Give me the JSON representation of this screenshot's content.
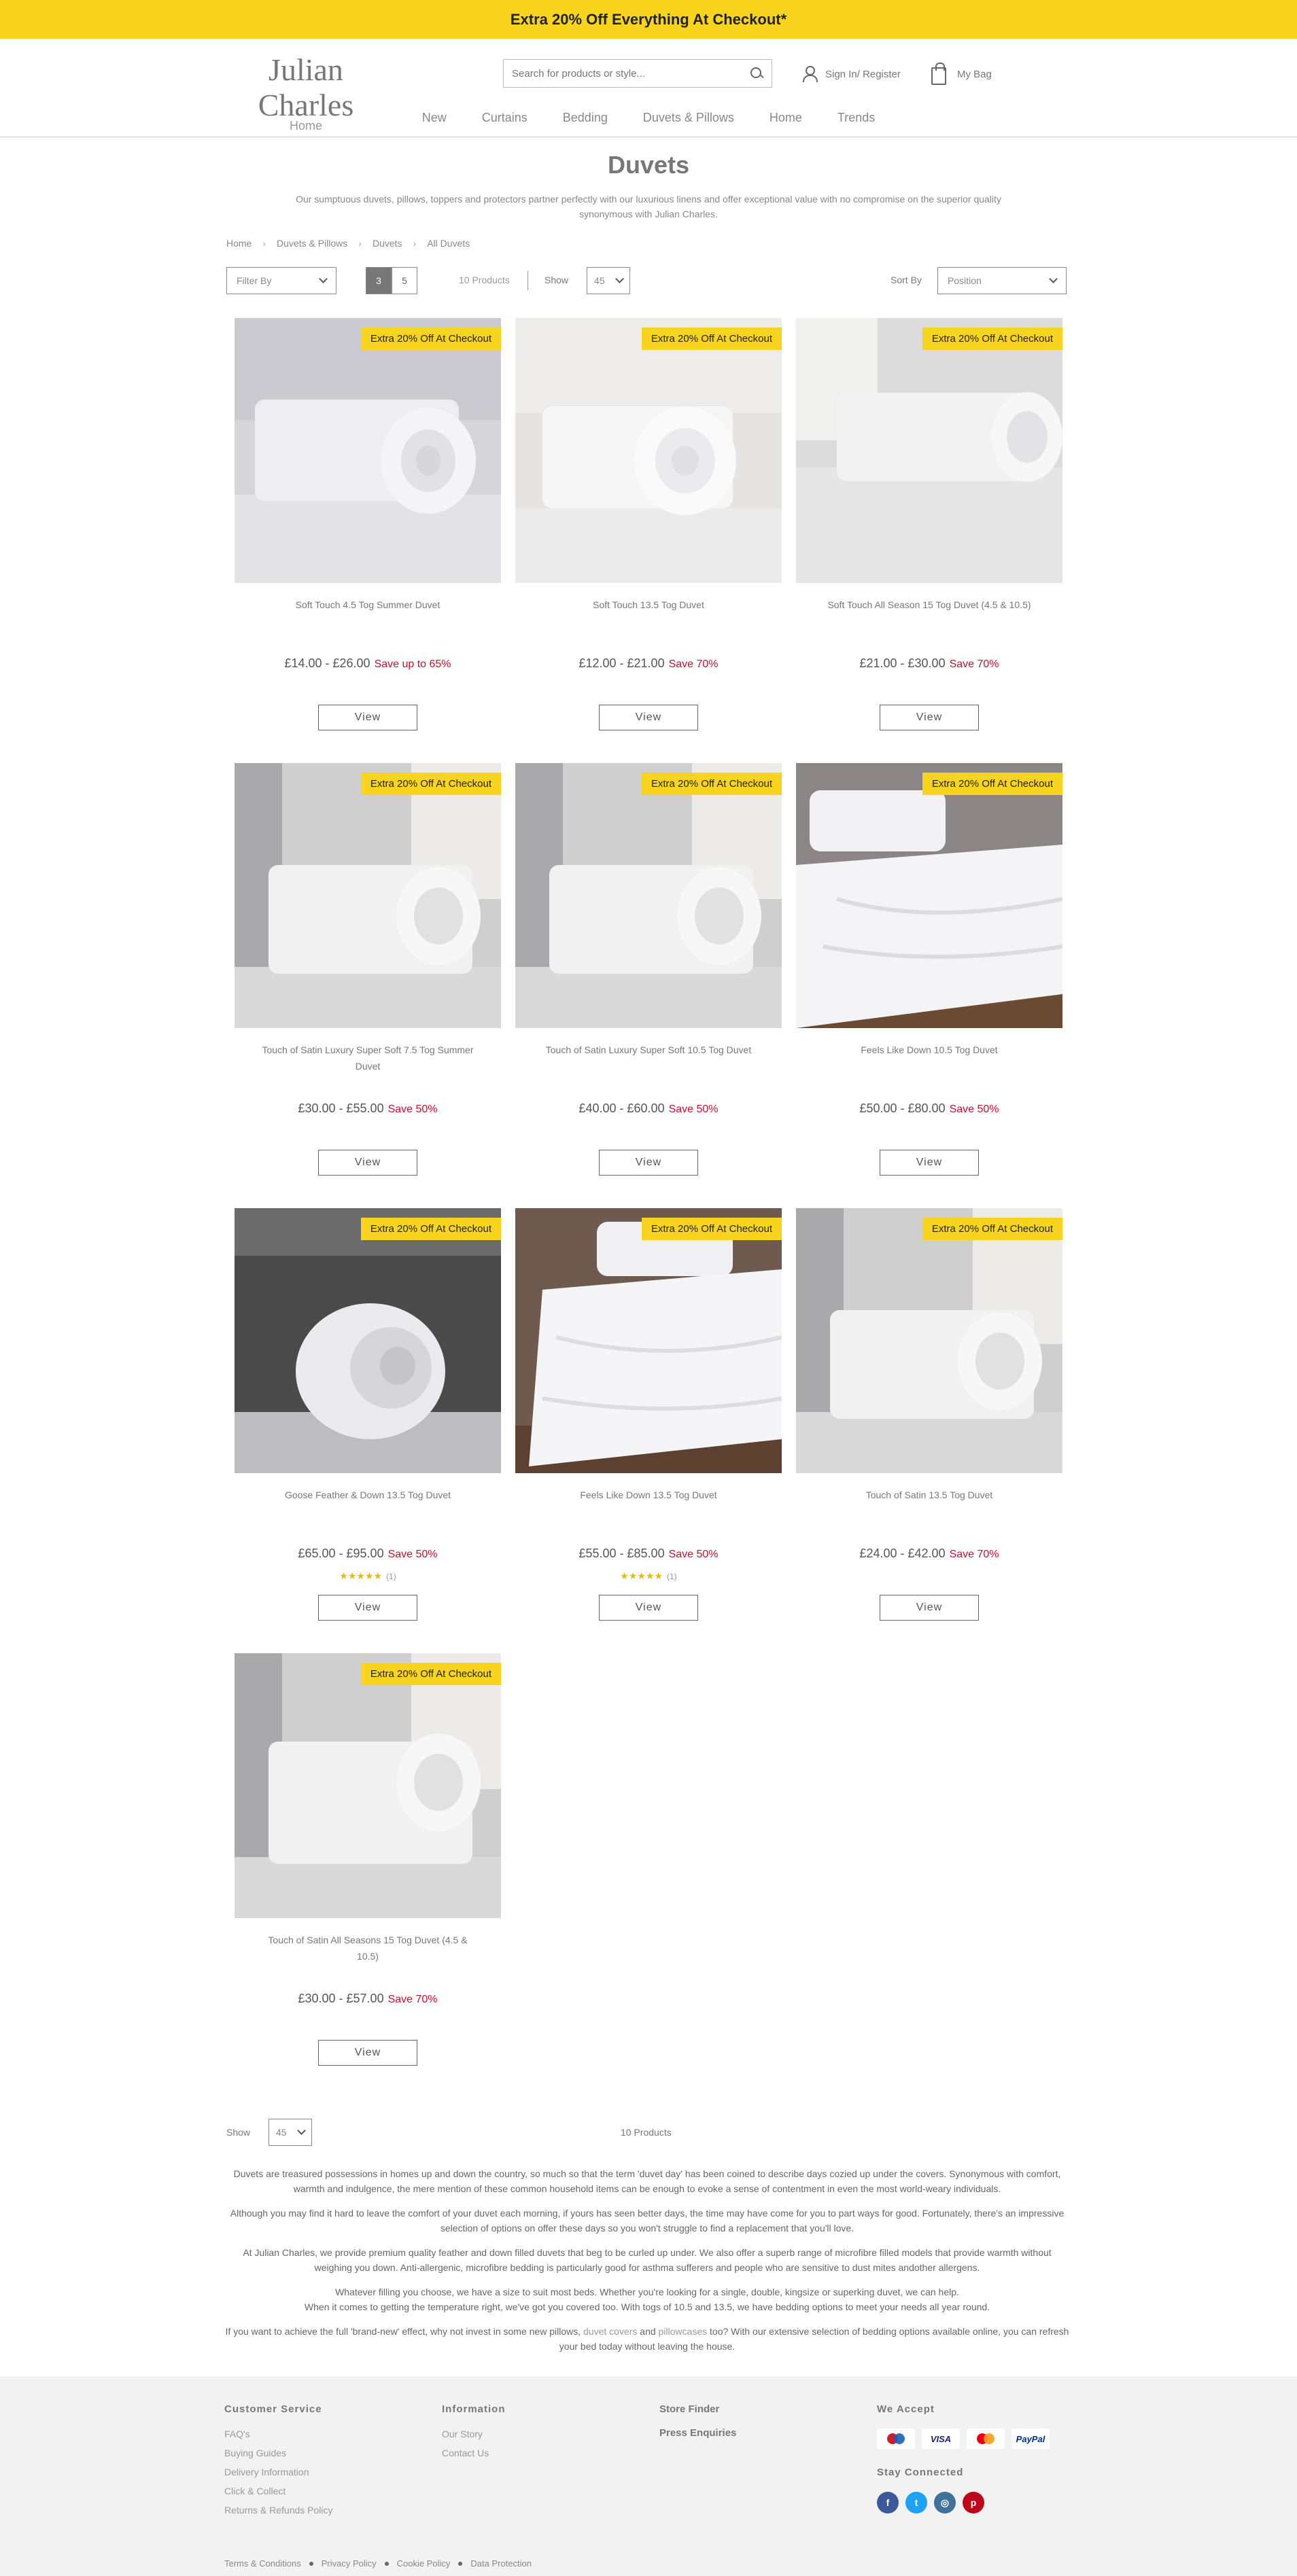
{
  "promo": {
    "text": "Extra 20% Off Everything At Checkout*"
  },
  "header": {
    "brand": "Julian Charles",
    "brand_sub": "Home",
    "search_placeholder": "Search for products or style...",
    "account": "Sign In/ Register",
    "bag": "My Bag"
  },
  "nav": [
    "New",
    "Curtains",
    "Bedding",
    "Duvets & Pillows",
    "Home",
    "Trends"
  ],
  "page": {
    "title": "Duvets",
    "intro": "Our sumptuous duvets, pillows, toppers and protectors partner perfectly with our luxurious linens and offer exceptional value with no compromise on the superior quality synonymous with Julian Charles."
  },
  "breadcrumb": [
    "Home",
    "Duvets & Pillows",
    "Duvets",
    "All Duvets"
  ],
  "toolbar": {
    "filter": "Filter By",
    "view_modes": [
      "3",
      "5"
    ],
    "count": "10 Products",
    "show_label": "Show",
    "show_value": "45",
    "sort_label": "Sort By",
    "sort_value": "Position"
  },
  "badge": "Extra 20% Off At Checkout",
  "view_label": "View",
  "products": [
    {
      "name": "Soft Touch 4.5 Tog Summer Duvet",
      "price": "£14.00 - £26.00",
      "save": "Save up to 65%",
      "rating": ""
    },
    {
      "name": "Soft Touch 13.5 Tog Duvet",
      "price": "£12.00 - £21.00",
      "save": "Save 70%",
      "rating": ""
    },
    {
      "name": "Soft Touch All Season 15 Tog Duvet (4.5 & 10.5)",
      "price": "£21.00 - £30.00",
      "save": "Save 70%",
      "rating": ""
    },
    {
      "name": "Touch of Satin Luxury Super Soft 7.5 Tog Summer Duvet",
      "price": "£30.00 - £55.00",
      "save": "Save 50%",
      "rating": ""
    },
    {
      "name": "Touch of Satin Luxury Super Soft 10.5 Tog Duvet",
      "price": "£40.00 - £60.00",
      "save": "Save 50%",
      "rating": ""
    },
    {
      "name": "Feels Like Down 10.5 Tog Duvet",
      "price": "£50.00 - £80.00",
      "save": "Save 50%",
      "rating": ""
    },
    {
      "name": "Goose Feather & Down 13.5 Tog Duvet",
      "price": "£65.00 - £95.00",
      "save": "Save 50%",
      "rating": "★★★★★",
      "rating_count": "(1)"
    },
    {
      "name": "Feels Like Down 13.5 Tog Duvet",
      "price": "£55.00 - £85.00",
      "save": "Save 50%",
      "rating": "★★★★★",
      "rating_count": "(1)"
    },
    {
      "name": "Touch of Satin 13.5 Tog Duvet",
      "price": "£24.00 - £42.00",
      "save": "Save 70%",
      "rating": ""
    },
    {
      "name": "Touch of Satin All Seasons 15 Tog Duvet (4.5 & 10.5)",
      "price": "£30.00 - £57.00",
      "save": "Save 70%",
      "rating": ""
    }
  ],
  "bottom": {
    "show_label": "Show",
    "show_value": "45",
    "count": "10 Products"
  },
  "seo": {
    "p1": "Duvets are treasured possessions in homes up and down the country, so much so that the term 'duvet day' has been coined to describe days cozied up under the covers. Synonymous with comfort, warmth and indulgence, the mere mention of these common household items can be enough to evoke a sense of contentment in even the most world-weary individuals.",
    "p2": "Although you may find it hard to leave the comfort of your duvet each morning, if yours has seen better days, the time may have come for you to part ways for good. Fortunately, there's an impressive selection of options on offer these days so you won't struggle to find a replacement that you'll love.",
    "p3": "At Julian Charles, we provide premium quality feather and down filled duvets that beg to be curled up under. We also offer a superb range of microfibre filled models that provide warmth without weighing you down. Anti-allergenic, microfibre bedding is particularly good for asthma sufferers and people who are sensitive to dust mites andother allergens.",
    "p4a": "Whatever filling you choose, we have a size to suit most beds. Whether you're looking for a single, double, kingsize or superking duvet, we can help.",
    "p4b": "When it comes to getting the temperature right, we've got you covered too. With togs of 10.5 and 13.5, we have bedding options to meet your needs all year round.",
    "p5_start": "If you want to achieve the full 'brand-new' effect, why not invest in some new pillows, ",
    "p5_link1": "duvet covers",
    "p5_and": " and ",
    "p5_link2": "pillowcases",
    "p5_end": " too? With our extensive selection of bedding options available online, you can refresh your bed today without leaving the house."
  },
  "footer": {
    "customer_service": {
      "title": "Customer Service",
      "links": [
        "FAQ's",
        "Buying Guides",
        "Delivery Information",
        "Click & Collect",
        "Returns & Refunds Policy"
      ]
    },
    "information": {
      "title": "Information",
      "links": [
        "Our Story",
        "Contact Us"
      ]
    },
    "other": {
      "links": [
        "Store Finder",
        "Press Enquiries"
      ]
    },
    "we_accept": "We Accept",
    "payments": [
      "VISA",
      "PayPal"
    ],
    "stay_connected": "Stay Connected",
    "legal": [
      "Terms & Conditions",
      "Privacy Policy",
      "Cookie Policy",
      "Data Protection"
    ]
  }
}
